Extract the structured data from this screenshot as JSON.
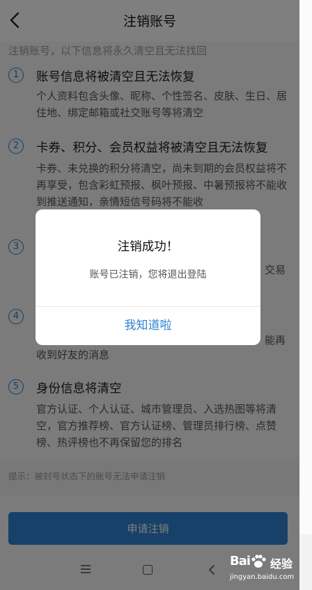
{
  "header": {
    "title": "注销账号"
  },
  "intro": "注销账号，以下信息将永久清空且无法找回",
  "items": [
    {
      "num": "1",
      "heading": "账号信息将被清空且无法恢复",
      "desc": "个人资料包含头像、昵称、个性签名、皮肤、生日、居住地、绑定邮箱或社交账号等将清空"
    },
    {
      "num": "2",
      "heading": "卡券、积分、会员权益将被清空且无法恢复",
      "desc": "卡券、未兑换的积分将清空，尚未到期的会员权益将不再享受，包含彩虹预报、枫叶预报、中暑预报将不能收到推送通知，亲情短信号码将不能收"
    },
    {
      "num": "3",
      "heading": "",
      "desc": "",
      "fragment": "交易"
    },
    {
      "num": "4",
      "heading": "",
      "desc": "收到好友的消息",
      "fragment": "能再"
    },
    {
      "num": "5",
      "heading": "身份信息将清空",
      "desc": "官方认证、个人认证、城市管理员、入选热图等将清空，官方推荐榜、官方认证榜、管理员排行榜、点赞榜、热评榜也不再保留您的排名"
    }
  ],
  "tip": "提示：被封号状态下的账号无法申请注销",
  "apply_button": "申请注销",
  "dialog": {
    "title": "注销成功！",
    "message": "账号已注销，您将退出登陆",
    "confirm": "我知道啦"
  },
  "watermark": {
    "logo": "Bai",
    "label": "经验",
    "url": "jingyan.baidu.com"
  },
  "colors": {
    "accent": "#2f83d3",
    "overlay": "rgba(0,0,0,0.5)"
  },
  "icons": [
    "back-arrow-icon",
    "menu-icon",
    "home-icon",
    "nav-back-icon",
    "baidu-paw-icon"
  ]
}
